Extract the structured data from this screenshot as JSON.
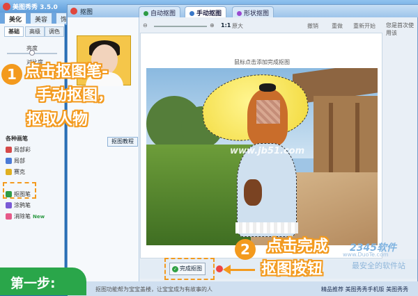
{
  "app": {
    "title": "美图秀秀 3.5.0"
  },
  "main_tabs": [
    "美化",
    "美容",
    "饰"
  ],
  "left_panel": {
    "subtabs": [
      "基础",
      "高级",
      "调色"
    ],
    "sliders": [
      "亮度",
      "对比度"
    ],
    "section_label": "各种画笔",
    "tools": [
      {
        "label": "局部彩",
        "color": "#d64a4a"
      },
      {
        "label": "局部",
        "color": "#4a7ad6"
      },
      {
        "label": "赛克",
        "color": "#e0b020"
      },
      {
        "label": "抠图笔",
        "color": "#2e9b45"
      },
      {
        "label": "涂鸦笔",
        "color": "#7a5ad6"
      },
      {
        "label": "消除笔",
        "color": "#e65a8a"
      }
    ],
    "new_badge": "New"
  },
  "dialog": {
    "title": "抠图",
    "tabs": [
      {
        "label": "自动抠图",
        "dot": "#2e9b45"
      },
      {
        "label": "手动抠图",
        "dot": "#3a78c8"
      },
      {
        "label": "形状抠图",
        "dot": "#9a4ad0"
      }
    ],
    "tutorial_button": "抠图教程",
    "toolbar": {
      "zoom_ratio": "1:1",
      "original_size": "原大",
      "undo": "撤销",
      "redo": "重做",
      "reset": "重新开始"
    },
    "hint_text": "鼠标点击添加完成抠图",
    "right_hint": "您是首次使用该",
    "complete_button": "完成抠图",
    "footer_text": "抠图功能帮为宝宝盖楼，让宝宝成为有故事的人",
    "footer_links": "精品推荐  美图秀秀手机版  美图秀秀"
  },
  "annotations": {
    "step1_number": "1",
    "step1_lines": [
      "点击抠图笔-",
      "手动抠图，",
      "抠取人物"
    ],
    "step2_number": "2",
    "step2_lines": [
      "点击完成",
      "抠图按钮"
    ],
    "step_banner": "第一步:",
    "photo_watermark": "www.jb51.com",
    "site_logo": "2345软件",
    "site_sub": "最安全的软件站",
    "site_url": "www.DuoTe.com"
  },
  "colors": {
    "accent": "#f39a1e",
    "green": "#2aa64a",
    "frame": "#2a6fb6"
  }
}
